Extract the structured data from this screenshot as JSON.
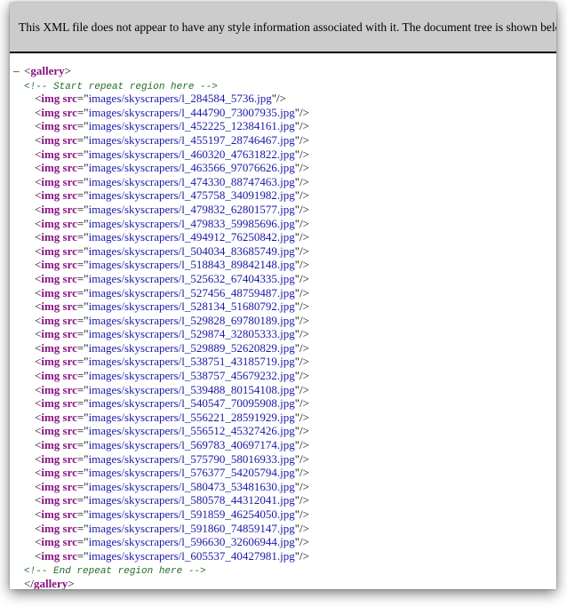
{
  "header": {
    "message": "This XML file does not appear to have any style information associated with it. The document tree is shown below."
  },
  "tree": {
    "collapse_glyph": "–",
    "root_tag": "gallery",
    "comment_start": "<!-- Start repeat region here -->",
    "comment_end": "<!-- End repeat region here -->",
    "child_tag": "img",
    "attr_name": "src",
    "images": [
      "images/skyscrapers/l_284584_5736.jpg",
      "images/skyscrapers/l_444790_73007935.jpg",
      "images/skyscrapers/l_452225_12384161.jpg",
      "images/skyscrapers/l_455197_28746467.jpg",
      "images/skyscrapers/l_460320_47631822.jpg",
      "images/skyscrapers/l_463566_97076626.jpg",
      "images/skyscrapers/l_474330_88747463.jpg",
      "images/skyscrapers/l_475758_34091982.jpg",
      "images/skyscrapers/l_479832_62801577.jpg",
      "images/skyscrapers/l_479833_59985696.jpg",
      "images/skyscrapers/l_494912_76250842.jpg",
      "images/skyscrapers/l_504034_83685749.jpg",
      "images/skyscrapers/l_518843_89842148.jpg",
      "images/skyscrapers/l_525632_67404335.jpg",
      "images/skyscrapers/l_527456_48759487.jpg",
      "images/skyscrapers/l_528134_51680792.jpg",
      "images/skyscrapers/l_529828_69780189.jpg",
      "images/skyscrapers/l_529874_32805333.jpg",
      "images/skyscrapers/l_529889_52620829.jpg",
      "images/skyscrapers/l_538751_43185719.jpg",
      "images/skyscrapers/l_538757_45679232.jpg",
      "images/skyscrapers/l_539488_80154108.jpg",
      "images/skyscrapers/l_540547_70095908.jpg",
      "images/skyscrapers/l_556221_28591929.jpg",
      "images/skyscrapers/l_556512_45327426.jpg",
      "images/skyscrapers/l_569783_40697174.jpg",
      "images/skyscrapers/l_575790_58016933.jpg",
      "images/skyscrapers/l_576377_54205794.jpg",
      "images/skyscrapers/l_580473_53481630.jpg",
      "images/skyscrapers/l_580578_44312041.jpg",
      "images/skyscrapers/l_591859_46254050.jpg",
      "images/skyscrapers/l_591860_74859147.jpg",
      "images/skyscrapers/l_596630_32606944.jpg",
      "images/skyscrapers/l_605537_40427981.jpg"
    ]
  }
}
